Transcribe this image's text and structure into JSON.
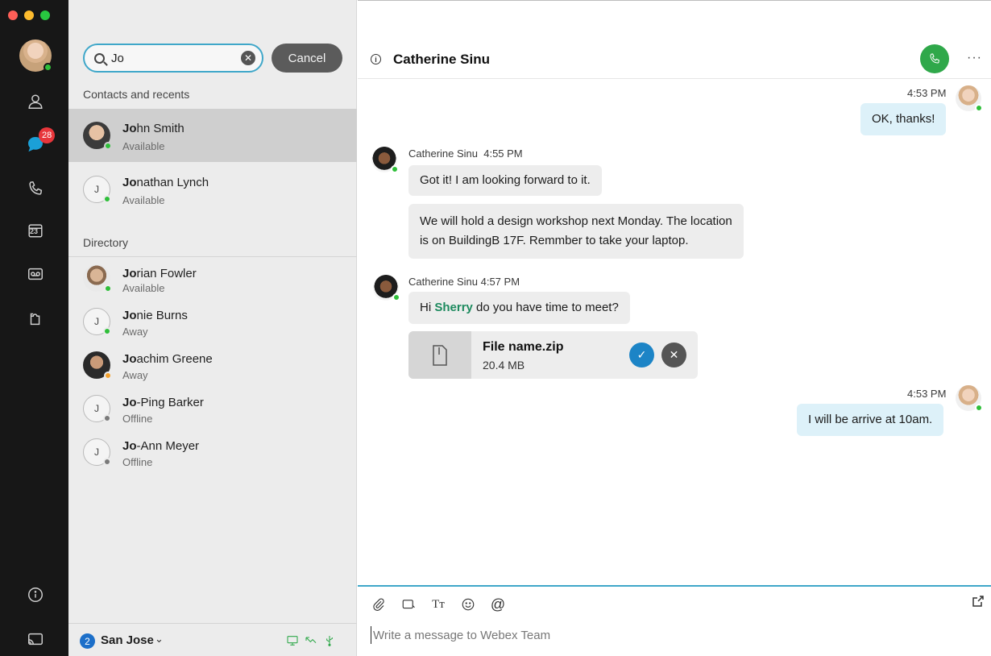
{
  "window": {
    "controls": [
      {
        "name": "close",
        "color": "#fe5f57"
      },
      {
        "name": "minimize",
        "color": "#febc2e"
      },
      {
        "name": "zoom",
        "color": "#28c840"
      }
    ]
  },
  "rail": {
    "unread_badge": "28",
    "icons": [
      "contacts-icon",
      "messaging-icon",
      "calls-icon",
      "calendar-icon",
      "voicemail-icon",
      "apps-icon",
      "help-icon",
      "cast-icon"
    ],
    "calendar_day": "23"
  },
  "search": {
    "value": "Jo",
    "cancel_label": "Cancel"
  },
  "contacts_section": {
    "label": "Contacts and recents",
    "items": [
      {
        "match": "Jo",
        "rest": "hn Smith",
        "status": "Available",
        "initial": "",
        "presence_color": "#2fbf3a",
        "selected": true
      },
      {
        "match": "Jo",
        "rest": "nathan Lynch",
        "status": "Available",
        "initial": "J",
        "presence_color": "#2fbf3a",
        "selected": false
      }
    ]
  },
  "directory_section": {
    "label": "Directory",
    "items": [
      {
        "match": "Jo",
        "rest": "rian Fowler",
        "status": "Available",
        "initial": "",
        "presence_color": "#2fbf3a"
      },
      {
        "match": "Jo",
        "rest": "nie Burns",
        "status": "Away",
        "initial": "J",
        "presence_color": "#2fbf3a"
      },
      {
        "match": "Jo",
        "rest": "achim Greene",
        "status": "Away",
        "initial": "",
        "presence_color": "#f2a12e"
      },
      {
        "match": "Jo",
        "rest": "-Ping Barker",
        "status": "Offline",
        "initial": "J",
        "presence_color": "#7a7a7a"
      },
      {
        "match": "Jo",
        "rest": "-Ann Meyer",
        "status": "Offline",
        "initial": "J",
        "presence_color": "#7a7a7a"
      }
    ]
  },
  "footer": {
    "location_count": "2",
    "location_name": "San Jose"
  },
  "chat": {
    "title": "Catherine Sinu",
    "messages": {
      "m1_time": "4:53 PM",
      "m1_text": "OK, thanks!",
      "m2_meta": "Catherine Sinu  4:55 PM",
      "m2_text_a": "Got it! I am looking forward to it.",
      "m2_text_b_line1": "We will hold a design workshop next Monday. The location",
      "m2_text_b_line2": "is on BuildingB 17F. Remmber to take your laptop.",
      "m3_meta": "Catherine Sinu 4:57 PM",
      "m3_pre": "Hi ",
      "m3_mention": "Sherry",
      "m3_post": " do you have time to meet?",
      "file_name": "File name.zip",
      "file_size": "20.4 MB",
      "m4_time": "4:53 PM",
      "m4_text": "I will be arrive at 10am."
    },
    "composer_placeholder": "Write a message to Webex Team"
  }
}
